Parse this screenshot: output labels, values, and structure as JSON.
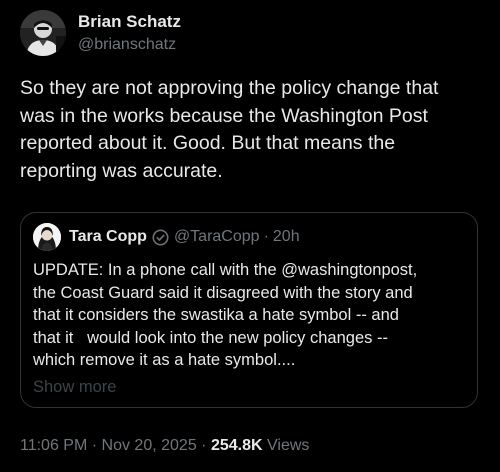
{
  "author": {
    "display_name": "Brian Schatz",
    "handle": "@brianschatz",
    "avatar_icon": "profile-photo"
  },
  "tweet": {
    "text": "So they are not approving the policy change that\nwas in the works because the Washington Post\nreported about it. Good. But that means the\nreporting was accurate."
  },
  "quoted": {
    "display_name": "Tara Copp",
    "badge_icon": "verified-badge-icon",
    "handle": "@TaraCopp",
    "separator": "·",
    "time": "20h",
    "text": "UPDATE: In a phone call with the @washingtonpost,\nthe Coast Guard said it disagreed with the story and\nthat it considers the swastika a hate symbol -- and\nthat it   would look into the new policy changes --\nwhich remove it as a hate symbol....",
    "show_more": "Show more"
  },
  "meta": {
    "time": "11:06 PM",
    "separator": "·",
    "date": "Nov 20, 2025",
    "views_count": "254.8K",
    "views_label": "Views"
  },
  "colors": {
    "background": "#000000",
    "text": "#e7e9ea",
    "muted": "#71767b",
    "border": "#2f3336"
  }
}
